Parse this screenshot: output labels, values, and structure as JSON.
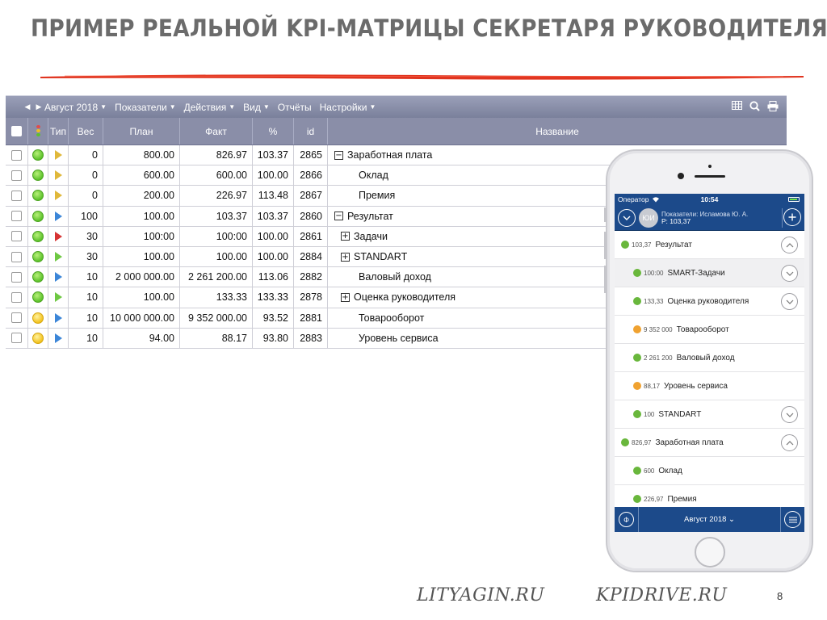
{
  "slide": {
    "title": "ПРИМЕР РЕАЛЬНОЙ KPI-МАТРИЦЫ СЕКРЕТАРЯ РУКОВОДИТЕЛЯ",
    "footer_left": "LITYAGIN.RU",
    "footer_right": "KPIDRIVE.RU",
    "page_number": "8",
    "accent_color": "#e0341f"
  },
  "toolbar": {
    "prev_icon": "prev-arrow-icon",
    "next_icon": "next-arrow-icon",
    "period": "Август 2018",
    "menu": [
      {
        "label": "Показатели",
        "dropdown": true
      },
      {
        "label": "Действия",
        "dropdown": true
      },
      {
        "label": "Вид",
        "dropdown": true
      },
      {
        "label": "Отчёты",
        "dropdown": false
      },
      {
        "label": "Настройки",
        "dropdown": true
      }
    ],
    "right_icons": [
      "table-icon",
      "search-icon",
      "print-icon"
    ]
  },
  "table": {
    "columns": [
      "",
      "",
      "Тип",
      "Вес",
      "План",
      "Факт",
      "%",
      "id",
      "Название"
    ],
    "rows": [
      {
        "status": "green",
        "type": "yellow",
        "ves": "0",
        "plan": "800.00",
        "fakt": "826.97",
        "pct": "103.37",
        "id": "2865",
        "tree": "−",
        "indent": 0,
        "name": "Заработная плата"
      },
      {
        "status": "green",
        "type": "yellow",
        "ves": "0",
        "plan": "600.00",
        "fakt": "600.00",
        "pct": "100.00",
        "id": "2866",
        "tree": "",
        "indent": 2,
        "name": "Оклад"
      },
      {
        "status": "green",
        "type": "yellow",
        "ves": "0",
        "plan": "200.00",
        "fakt": "226.97",
        "pct": "113.48",
        "id": "2867",
        "tree": "",
        "indent": 2,
        "name": "Премия"
      },
      {
        "status": "green",
        "type": "blue",
        "ves": "100",
        "plan": "100.00",
        "fakt": "103.37",
        "pct": "103.37",
        "id": "2860",
        "tree": "−",
        "indent": 0,
        "name": "Результат"
      },
      {
        "status": "green",
        "type": "red",
        "ves": "30",
        "plan": "100:00",
        "fakt": "100:00",
        "pct": "100.00",
        "id": "2861",
        "tree": "+",
        "indent": 1,
        "name": "Задачи"
      },
      {
        "status": "green",
        "type": "green",
        "ves": "30",
        "plan": "100.00",
        "fakt": "100.00",
        "pct": "100.00",
        "id": "2884",
        "tree": "+",
        "indent": 1,
        "name": "STANDART"
      },
      {
        "status": "green",
        "type": "blue",
        "ves": "10",
        "plan": "2 000 000.00",
        "fakt": "2 261 200.00",
        "pct": "113.06",
        "id": "2882",
        "tree": "",
        "indent": 2,
        "name": "Валовый доход"
      },
      {
        "status": "green",
        "type": "green",
        "ves": "10",
        "plan": "100.00",
        "fakt": "133.33",
        "pct": "133.33",
        "id": "2878",
        "tree": "+",
        "indent": 1,
        "name": "Оценка руководителя"
      },
      {
        "status": "yellow",
        "type": "blue",
        "ves": "10",
        "plan": "10 000 000.00",
        "fakt": "9 352 000.00",
        "pct": "93.52",
        "id": "2881",
        "tree": "",
        "indent": 2,
        "name": "Товарооборот"
      },
      {
        "status": "yellow",
        "type": "blue",
        "ves": "10",
        "plan": "94.00",
        "fakt": "88.17",
        "pct": "93.80",
        "id": "2883",
        "tree": "",
        "indent": 2,
        "name": "Уровень сервиса"
      }
    ]
  },
  "phone": {
    "carrier": "Оператор",
    "time": "10:54",
    "avatar_initials": "ЮИ",
    "header_line1": "Показатели: Исламова Ю. А.",
    "header_line2": "Р: 103,37",
    "items": [
      {
        "level": 0,
        "dot": "green",
        "value": "103,37",
        "label": "Результат",
        "chevron": "up"
      },
      {
        "level": 2,
        "dot": "green",
        "value": "100:00",
        "label": "SMART-Задачи",
        "chevron": "down"
      },
      {
        "level": 1,
        "dot": "green",
        "value": "133,33",
        "label": "Оценка руководителя",
        "chevron": "down"
      },
      {
        "level": 1,
        "dot": "orange",
        "value": "9 352 000",
        "label": "Товарооборот",
        "chevron": ""
      },
      {
        "level": 1,
        "dot": "green",
        "value": "2 261 200",
        "label": "Валовый доход",
        "chevron": ""
      },
      {
        "level": 1,
        "dot": "orange",
        "value": "88,17",
        "label": "Уровень сервиса",
        "chevron": ""
      },
      {
        "level": 1,
        "dot": "green",
        "value": "100",
        "label": "STANDART",
        "chevron": "down"
      },
      {
        "level": 0,
        "dot": "green",
        "value": "826,97",
        "label": "Заработная плата",
        "chevron": "up"
      },
      {
        "level": 1,
        "dot": "green",
        "value": "600",
        "label": "Оклад",
        "chevron": ""
      },
      {
        "level": 1,
        "dot": "green",
        "value": "226,97",
        "label": "Премия",
        "chevron": ""
      }
    ],
    "footer_left_glyph": "Ф",
    "footer_period": "Август 2018 ⌄",
    "colors": {
      "bar": "#1c4a8a",
      "green": "#69b73c",
      "orange": "#f0a230"
    }
  }
}
